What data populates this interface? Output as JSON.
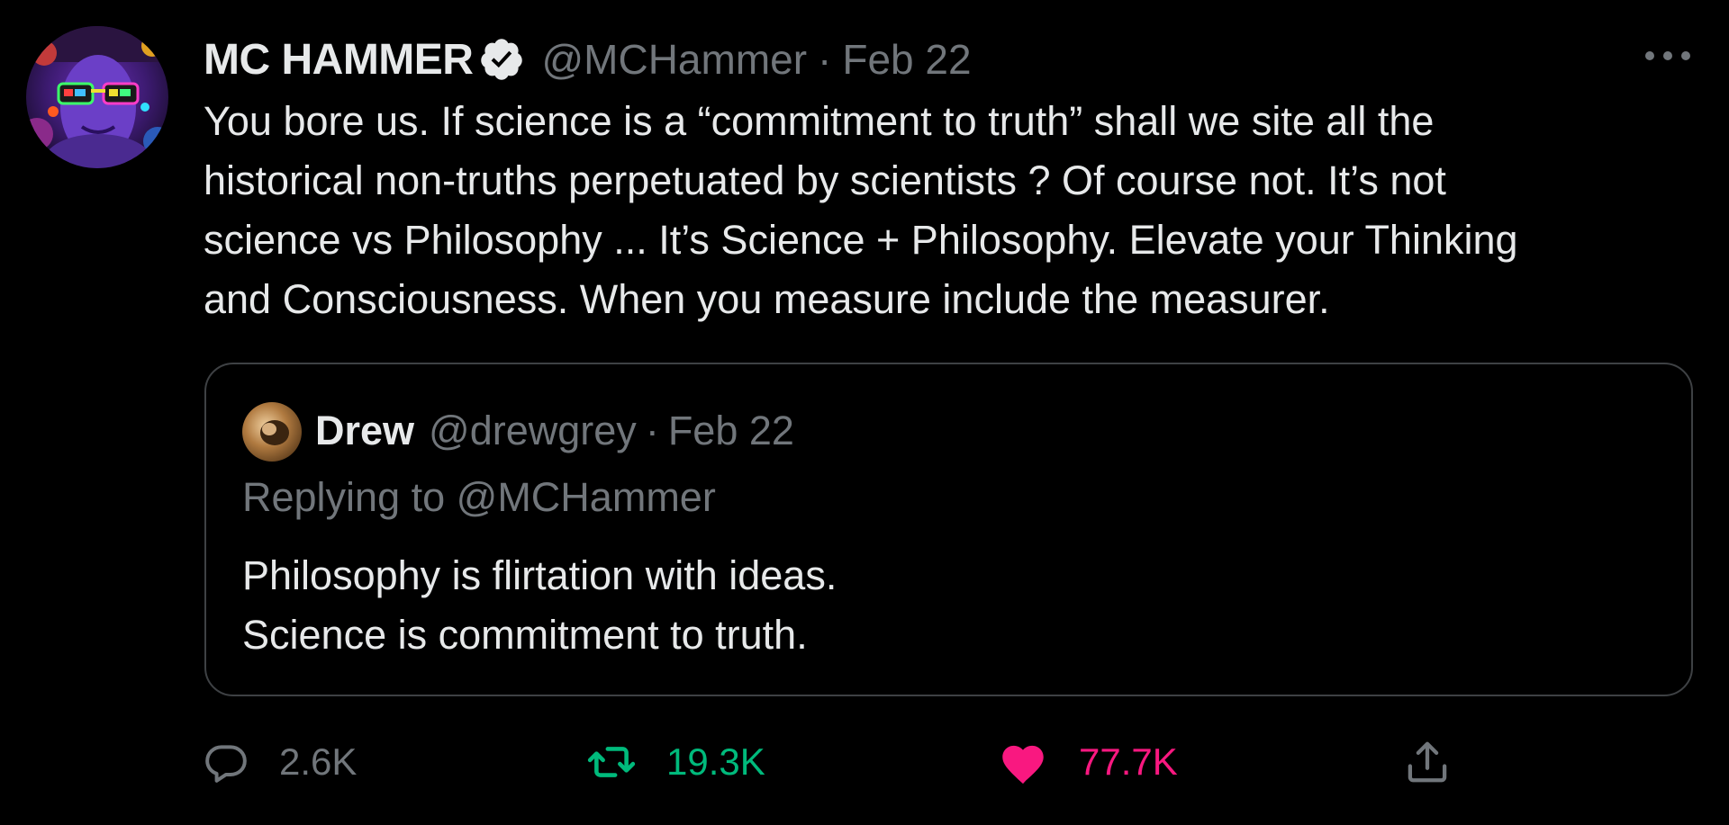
{
  "tweet": {
    "author": {
      "display_name": "MC HAMMER",
      "handle": "@MCHammer",
      "verified": true
    },
    "separator": "·",
    "date": "Feb 22",
    "text": "You bore us. If science is a “commitment to truth” shall we site all the\nhistorical non-truths perpetuated by scientists ? Of course not. It’s not\nscience vs Philosophy ... It’s Science + Philosophy. Elevate your Thinking\nand Consciousness. When you measure include the measurer.",
    "more_icon": "more-horizontal-icon"
  },
  "quoted_tweet": {
    "author": {
      "display_name": "Drew",
      "handle": "@drewgrey"
    },
    "separator": "·",
    "date": "Feb 22",
    "replying_prefix": "Replying to ",
    "replying_to": "@MCHammer",
    "text": "Philosophy is flirtation with ideas.\nScience is commitment to truth."
  },
  "actions": {
    "reply": {
      "icon": "reply-icon",
      "count": "2.6K"
    },
    "retweet": {
      "icon": "retweet-icon",
      "count": "19.3K"
    },
    "like": {
      "icon": "heart-icon",
      "count": "77.7K"
    },
    "share": {
      "icon": "share-icon"
    }
  },
  "colors": {
    "background": "#000000",
    "text_primary": "#e7e9ea",
    "text_secondary": "#71767b",
    "quote_border": "#3e4144",
    "retweet_green": "#00ba7c",
    "like_pink": "#f91880"
  }
}
